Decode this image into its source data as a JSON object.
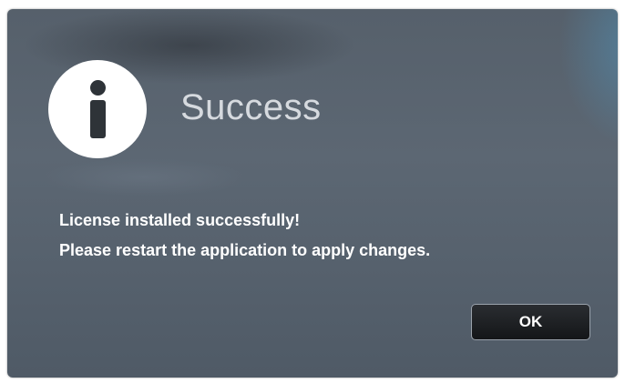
{
  "dialog": {
    "icon": "info-icon",
    "title": "Success",
    "message_lines": [
      "License installed successfully!",
      "Please restart the application to apply changes."
    ],
    "ok_label": "OK"
  },
  "colors": {
    "dialog_background": "#5a6571",
    "title_text": "#d6dadf",
    "message_text": "#ffffff",
    "button_background": "#1e2124"
  }
}
